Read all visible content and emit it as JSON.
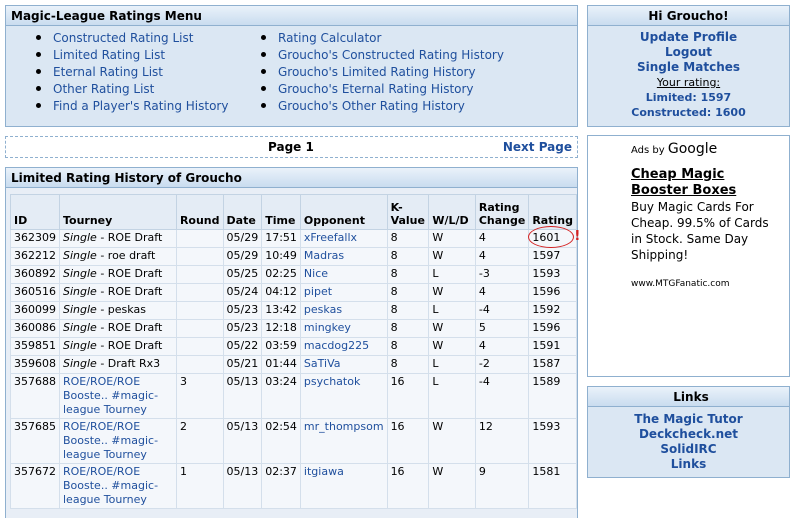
{
  "menu": {
    "title": "Magic-League Ratings Menu",
    "left_items": [
      "Constructed Rating List",
      "Limited Rating List",
      "Eternal Rating List",
      "Other Rating List",
      "Find a Player's Rating History"
    ],
    "right_items": [
      "Rating Calculator",
      "Groucho's Constructed Rating History",
      "Groucho's Limited Rating History",
      "Groucho's Eternal Rating History",
      "Groucho's Other Rating History"
    ]
  },
  "pagebar": {
    "page": "Page 1",
    "next": "Next Page"
  },
  "history": {
    "title": "Limited Rating History of Groucho",
    "columns": [
      "ID",
      "Tourney",
      "Round",
      "Date",
      "Time",
      "Opponent",
      "K-Value",
      "W/L/D",
      "Rating Change",
      "Rating"
    ],
    "rows": [
      {
        "id": "362309",
        "tourney_type": "Single",
        "tourney": " - ROE Draft",
        "round": "",
        "date": "05/29",
        "time": "17:51",
        "opponent": "xFreefallx",
        "k": "8",
        "wld": "W",
        "change": "4",
        "rating": "1601"
      },
      {
        "id": "362212",
        "tourney_type": "Single",
        "tourney": " - roe draft",
        "round": "",
        "date": "05/29",
        "time": "10:49",
        "opponent": "Madras",
        "k": "8",
        "wld": "W",
        "change": "4",
        "rating": "1597"
      },
      {
        "id": "360892",
        "tourney_type": "Single",
        "tourney": " - ROE Draft",
        "round": "",
        "date": "05/25",
        "time": "02:25",
        "opponent": "Nice",
        "k": "8",
        "wld": "L",
        "change": "-3",
        "rating": "1593"
      },
      {
        "id": "360516",
        "tourney_type": "Single",
        "tourney": " - ROE Draft",
        "round": "",
        "date": "05/24",
        "time": "04:12",
        "opponent": "pipet",
        "k": "8",
        "wld": "W",
        "change": "4",
        "rating": "1596"
      },
      {
        "id": "360099",
        "tourney_type": "Single",
        "tourney": " - peskas",
        "round": "",
        "date": "05/23",
        "time": "13:42",
        "opponent": "peskas",
        "k": "8",
        "wld": "L",
        "change": "-4",
        "rating": "1592"
      },
      {
        "id": "360086",
        "tourney_type": "Single",
        "tourney": " - ROE Draft",
        "round": "",
        "date": "05/23",
        "time": "12:18",
        "opponent": "mingkey",
        "k": "8",
        "wld": "W",
        "change": "5",
        "rating": "1596"
      },
      {
        "id": "359851",
        "tourney_type": "Single",
        "tourney": " - ROE Draft",
        "round": "",
        "date": "05/22",
        "time": "03:59",
        "opponent": "macdog225",
        "k": "8",
        "wld": "W",
        "change": "4",
        "rating": "1591"
      },
      {
        "id": "359608",
        "tourney_type": "Single",
        "tourney": " - Draft Rx3",
        "round": "",
        "date": "05/21",
        "time": "01:44",
        "opponent": "SaTiVa",
        "k": "8",
        "wld": "L",
        "change": "-2",
        "rating": "1587"
      },
      {
        "id": "357688",
        "tourney_type": "",
        "tourney": "ROE/ROE/ROE Booste.. #magic-league Tourney",
        "round": "3",
        "date": "05/13",
        "time": "03:24",
        "opponent": "psychatok",
        "k": "16",
        "wld": "L",
        "change": "-4",
        "rating": "1589"
      },
      {
        "id": "357685",
        "tourney_type": "",
        "tourney": "ROE/ROE/ROE Booste.. #magic-league Tourney",
        "round": "2",
        "date": "05/13",
        "time": "02:54",
        "opponent": "mr_thompsom",
        "k": "16",
        "wld": "W",
        "change": "12",
        "rating": "1593"
      },
      {
        "id": "357672",
        "tourney_type": "",
        "tourney": "ROE/ROE/ROE Booste.. #magic-league Tourney",
        "round": "1",
        "date": "05/13",
        "time": "02:37",
        "opponent": "itgiawa",
        "k": "16",
        "wld": "W",
        "change": "9",
        "rating": "1581"
      }
    ],
    "alert_mark": "!"
  },
  "greet": {
    "title": "Hi Groucho!",
    "update": "Update Profile",
    "logout": "Logout",
    "single": "Single Matches",
    "your_rating": "Your rating:",
    "limited": "Limited: 1597",
    "constructed": "Constructed: 1600"
  },
  "ads": {
    "adsby": "Ads by",
    "google": "Google",
    "title": "Cheap Magic Booster Boxes",
    "text": "Buy Magic Cards For Cheap. 99.5% of Cards in Stock. Same Day Shipping!",
    "url": "www.MTGFanatic.com"
  },
  "links": {
    "title": "Links",
    "items": [
      "The Magic Tutor",
      "Deckcheck.net",
      "SolidIRC",
      "Links"
    ]
  },
  "colors": {
    "link": "#1f4f9d",
    "panel": "#dbe7f3",
    "border": "#8fb0cf",
    "alert": "#d42020"
  }
}
